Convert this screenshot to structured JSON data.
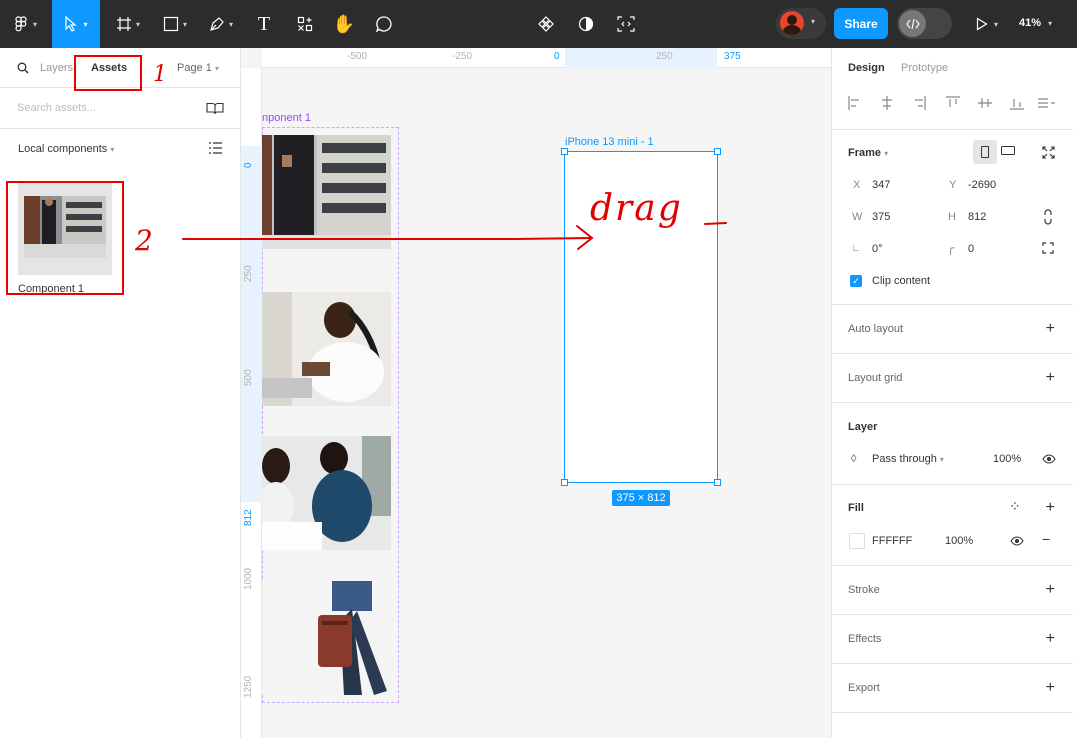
{
  "toolbar": {
    "share_label": "Share",
    "zoom_label": "41%"
  },
  "left_panel": {
    "tabs": [
      "Layers",
      "Assets"
    ],
    "page_label": "Page 1",
    "search_placeholder": "Search assets...",
    "section_title": "Local components",
    "components": [
      {
        "label": "Component 1"
      }
    ]
  },
  "canvas": {
    "ruler_top": [
      "-500",
      "-250",
      "0",
      "250",
      "375"
    ],
    "ruler_left": [
      "0",
      "250",
      "500",
      "812",
      "1000",
      "1250"
    ],
    "component_label": "nponent 1",
    "frame_label": "iPhone 13 mini - 1",
    "frame_dimensions": "375 × 812"
  },
  "right_panel": {
    "tabs": [
      "Design",
      "Prototype"
    ],
    "frame_section": "Frame",
    "x_label": "X",
    "x_value": "347",
    "y_label": "Y",
    "y_value": "-2690",
    "w_label": "W",
    "w_value": "375",
    "h_label": "H",
    "h_value": "812",
    "rotation_value": "0°",
    "radius_value": "0",
    "clip_label": "Clip content",
    "auto_layout": "Auto layout",
    "layout_grid": "Layout grid",
    "layer_title": "Layer",
    "blend_mode": "Pass through",
    "layer_opacity": "100%",
    "fill_title": "Fill",
    "fill_hex": "FFFFFF",
    "fill_opacity": "100%",
    "stroke": "Stroke",
    "effects": "Effects",
    "export": "Export"
  },
  "annotations": {
    "step1": "1",
    "step2": "2",
    "drag_text": "drag"
  },
  "colors": {
    "toolbar_bg": "#2c2c2c",
    "accent": "#0d99ff",
    "component_purple": "#9747ff",
    "annotation_red": "#e00000"
  }
}
